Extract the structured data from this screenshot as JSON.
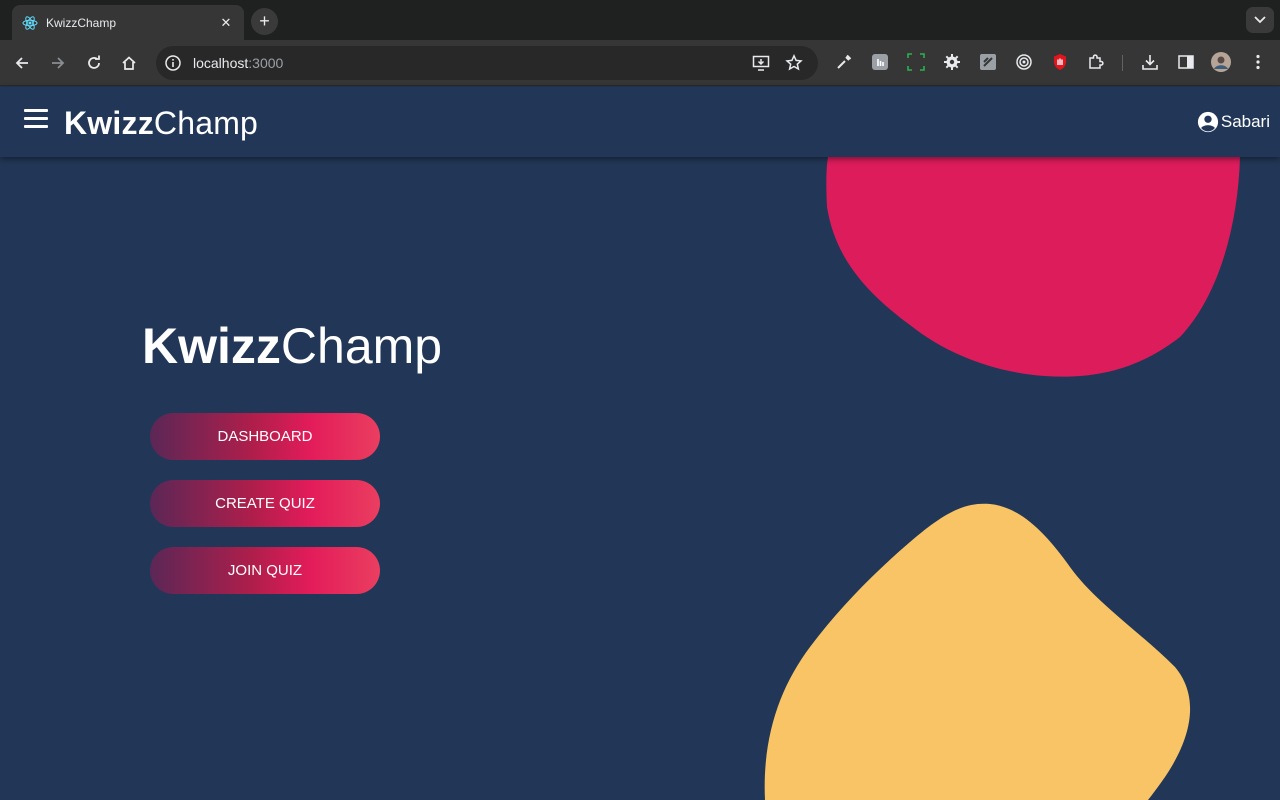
{
  "browser": {
    "tab_title": "KwizzChamp",
    "tab_close": "✕",
    "new_tab": "+",
    "url_host": "localhost",
    "url_port": ":3000"
  },
  "header": {
    "logo_bold": "Kwizz",
    "logo_light": "Champ",
    "user_name": "Sabari"
  },
  "hero": {
    "logo_bold": "Kwizz",
    "logo_light": "Champ"
  },
  "buttons": {
    "dashboard": "DASHBOARD",
    "create_quiz": "CREATE QUIZ",
    "join_quiz": "JOIN QUIZ"
  },
  "colors": {
    "background": "#223757",
    "blob_pink": "#dd1c5c",
    "blob_yellow": "#f8c465",
    "button_gradient_start": "#5b2756",
    "button_gradient_end": "#ea3e60"
  }
}
